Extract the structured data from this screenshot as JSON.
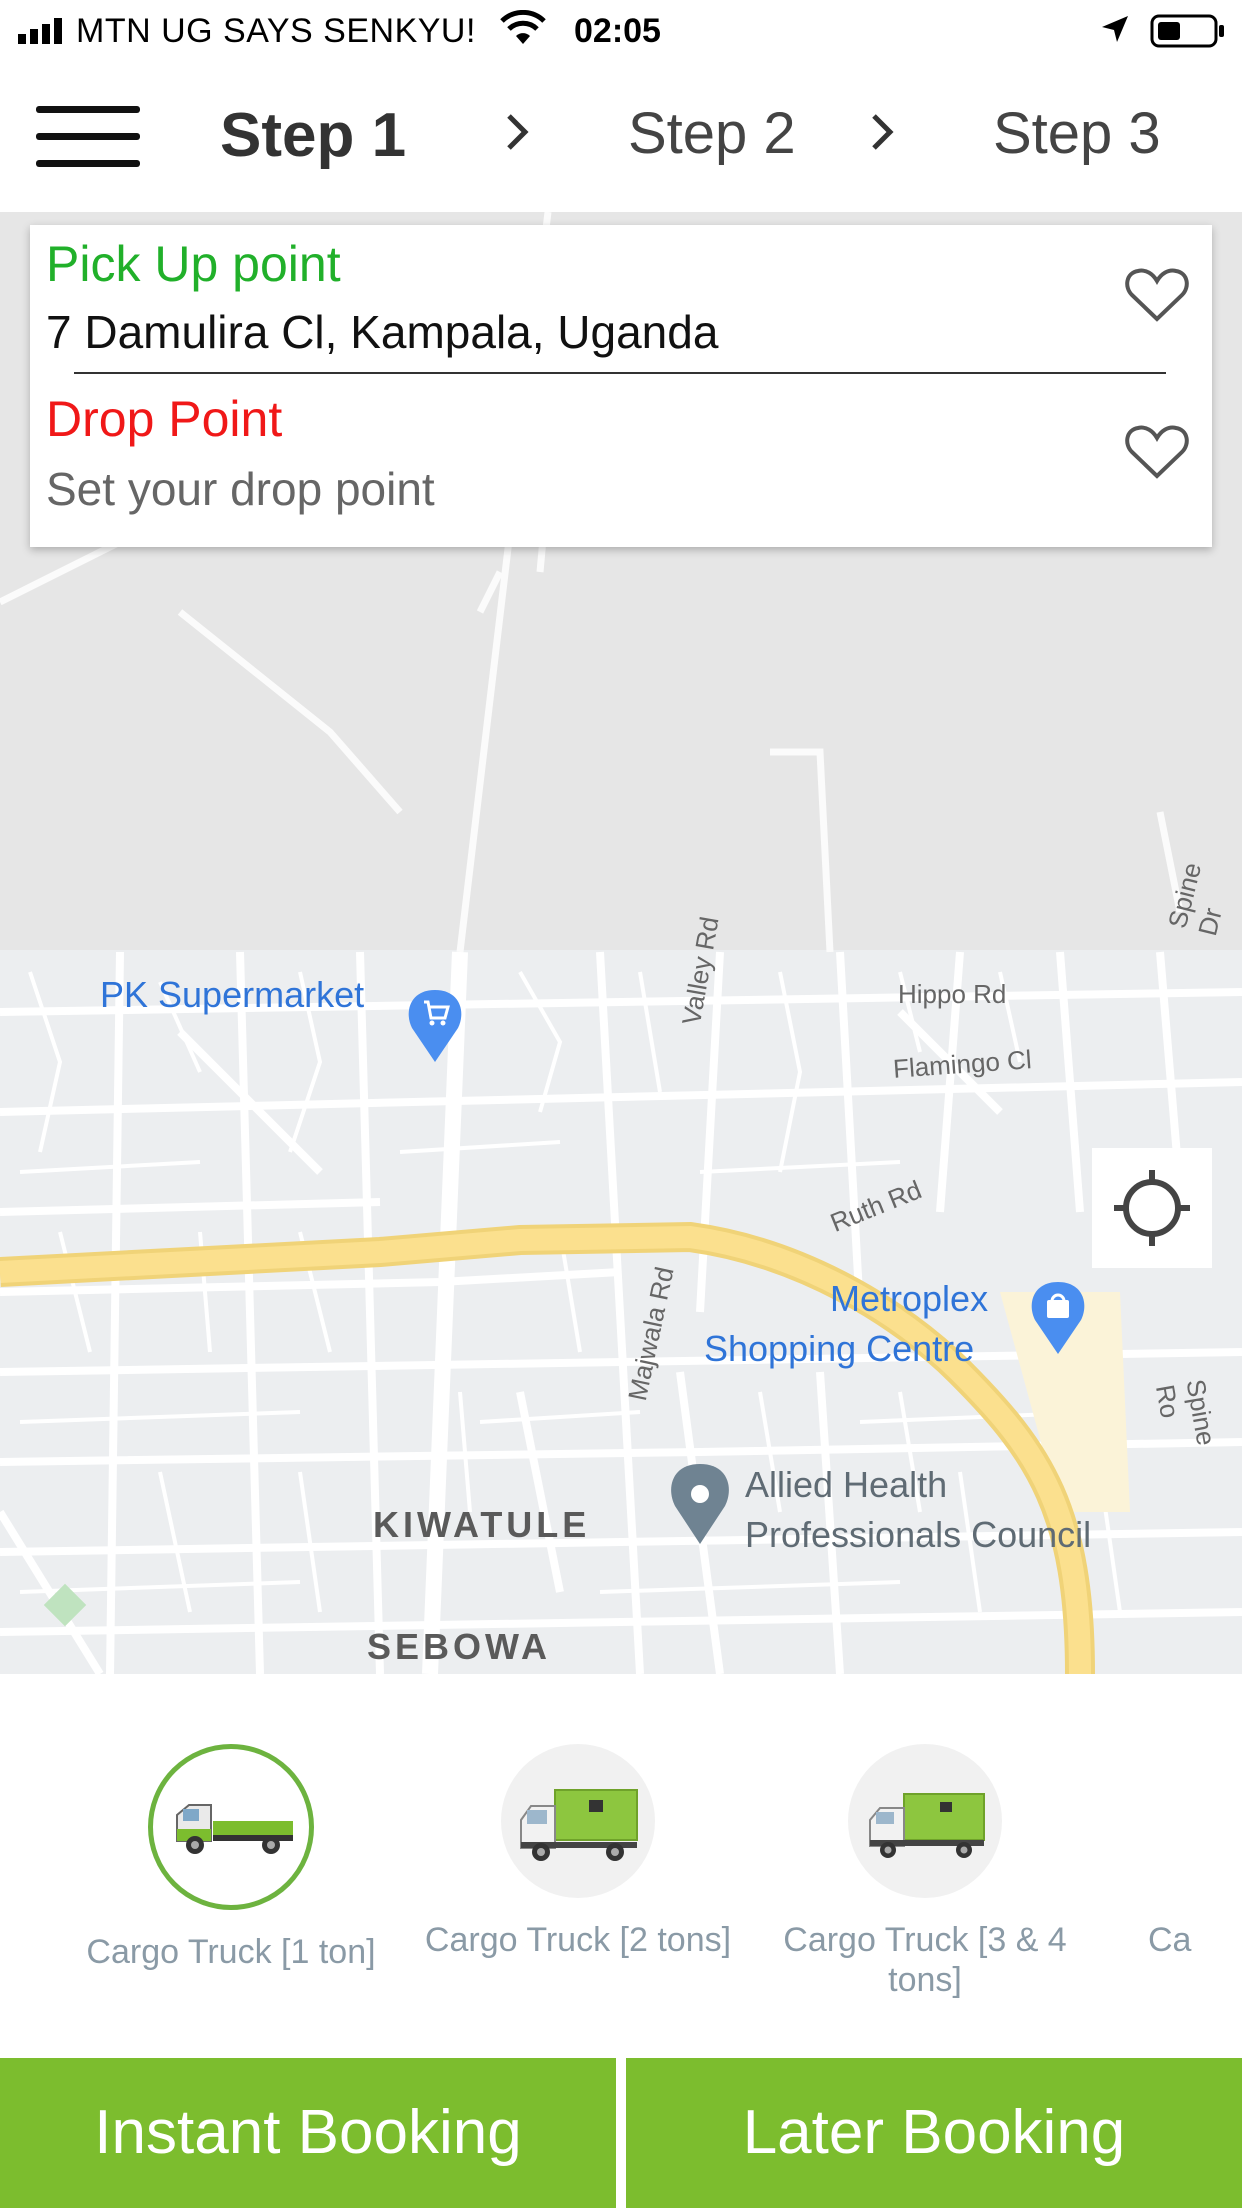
{
  "status_bar": {
    "carrier": "MTN UG SAYS SENKYU!",
    "time": "02:05"
  },
  "header": {
    "steps": [
      "Step 1",
      "Step 2",
      "Step 3"
    ]
  },
  "address_card": {
    "pickup_label": "Pick Up point",
    "pickup_value": "7 Damulira Cl, Kampala, Uganda",
    "drop_label": "Drop Point",
    "drop_placeholder": "Set your drop point"
  },
  "map": {
    "places": {
      "pk_supermarket": "PK Supermarket",
      "metroplex_1": "Metroplex",
      "metroplex_2": "Shopping Centre",
      "allied_1": "Allied Health",
      "allied_2": "Professionals Council",
      "kiwatule": "KIWATULE",
      "sebowa": "SEBOWA"
    },
    "roads": {
      "hippo": "Hippo Rd",
      "flamingo": "Flamingo Cl",
      "valley": "Valley Rd",
      "ruth": "Ruth Rd",
      "majwala": "Majwala Rd",
      "spine_top": "Spine Dr",
      "spine_right": "Spine Ro"
    }
  },
  "vehicles": [
    {
      "name": "Cargo Truck [1 ton]",
      "selected": true
    },
    {
      "name": "Cargo Truck [2 tons]",
      "selected": false
    },
    {
      "name": "Cargo Truck [3 & 4 tons]",
      "selected": false
    },
    {
      "name": "Ca",
      "selected": false
    }
  ],
  "actions": {
    "instant": "Instant Booking",
    "later": "Later Booking"
  },
  "colors": {
    "accent": "#7cbd2e",
    "pickup": "#21b02a",
    "drop": "#f01818"
  }
}
